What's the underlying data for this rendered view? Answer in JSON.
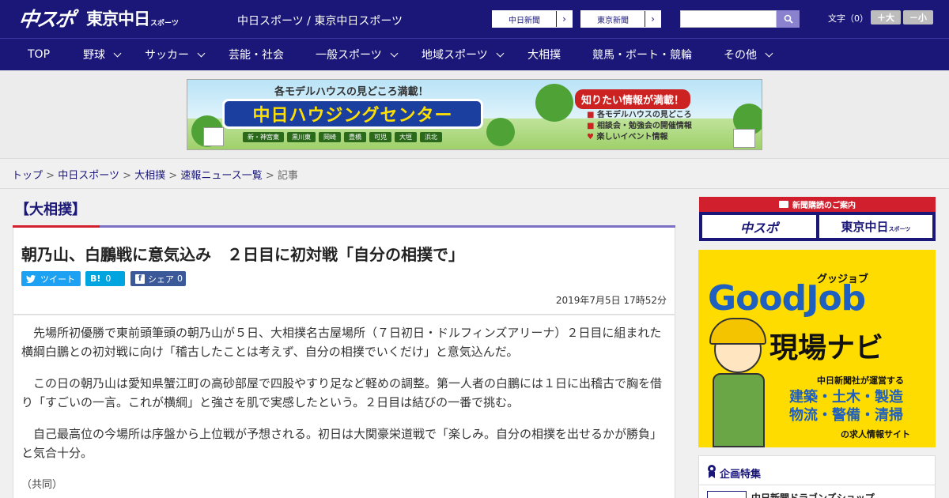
{
  "header": {
    "logo_main": "中スポ",
    "logo_sub": "東京中日",
    "logo_sub_small": "スポーツ",
    "site_title": "中日スポーツ / 東京中日スポーツ",
    "links": [
      {
        "label": "中日新聞"
      },
      {
        "label": "東京新聞"
      }
    ],
    "search_placeholder": "",
    "font_size_label": "文字（0）",
    "font_larger": "＋大",
    "font_smaller": "－小"
  },
  "nav": {
    "items": [
      {
        "label": "TOP",
        "dropdown": false
      },
      {
        "label": "野球",
        "dropdown": true
      },
      {
        "label": "サッカー",
        "dropdown": true
      },
      {
        "label": "芸能・社会",
        "dropdown": false
      },
      {
        "label": "一般スポーツ",
        "dropdown": true
      },
      {
        "label": "地域スポーツ",
        "dropdown": true
      },
      {
        "label": "大相撲",
        "dropdown": false
      },
      {
        "label": "競馬・ボート・競輪",
        "dropdown": false
      },
      {
        "label": "その他",
        "dropdown": true
      }
    ]
  },
  "banner": {
    "tagline": "各モデルハウスの見どころ満載！",
    "title": "中日ハウジングセンター",
    "cities": [
      "新・神宮東",
      "黒川東",
      "岡崎",
      "豊橋",
      "可児",
      "大垣",
      "浜北"
    ],
    "right_head": "知りたい情報が満載！",
    "bullets": [
      "各モデルハウスの見どころ",
      "相談会・勉強会の開催情報",
      "楽しいイベント情報"
    ]
  },
  "breadcrumb": {
    "items": [
      "トップ",
      "中日スポーツ",
      "大相撲",
      "速報ニュース一覧"
    ],
    "current": "記事",
    "separator": ">"
  },
  "article": {
    "category": "【大相撲】",
    "headline": "朝乃山、白鵬戦に意気込み　２日目に初対戦「自分の相撲で」",
    "share": {
      "tweet_icon": "bird-icon",
      "tweet": "ツイート",
      "hatena_icon": "B!",
      "hatena_count": "0",
      "facebook_icon": "f",
      "facebook": "シェア",
      "facebook_count": "0"
    },
    "date": "2019年7月5日 17時52分",
    "paragraphs": [
      "先場所初優勝で東前頭筆頭の朝乃山が５日、大相撲名古屋場所（７日初日・ドルフィンズアリーナ）２日目に組まれた横綱白鵬との初対戦に向け「稽古したことは考えず、自分の相撲でいくだけ」と意気込んだ。",
      "この日の朝乃山は愛知県蟹江町の高砂部屋で四股やすり足など軽めの調整。第一人者の白鵬には１日に出稽古で胸を借り「すごいの一言。これが横綱」と強さを肌で実感したという。２日目は結びの一番で挑む。",
      "自己最高位の今場所は序盤から上位戦が予想される。初日は大関豪栄道戦で「楽しみ。自分の相撲を出せるかが勝負」と気合十分。"
    ],
    "credit": "（共同）"
  },
  "sidebar": {
    "subscribe_head": "新聞購読のご案内",
    "subscribe_buttons": [
      "中スポ",
      "東京中日"
    ],
    "subscribe_small": "スポーツ",
    "ad": {
      "small": "グッジョブ",
      "big": "GoodJob",
      "genba": "現場ナビ",
      "operator": "中日新聞社が運営する",
      "categories": [
        "建築・土木・製造",
        "物流・警備・清掃"
      ],
      "site": "の求人情報サイト"
    },
    "feature": {
      "title": "企画特集",
      "item": "中日新聞ドラゴンズショップ"
    }
  },
  "colors": {
    "brand_navy": "#1a1778",
    "accent_red": "#d21f2d",
    "twitter": "#1da1f2",
    "hatena": "#00a4de",
    "facebook": "#3b5998"
  }
}
